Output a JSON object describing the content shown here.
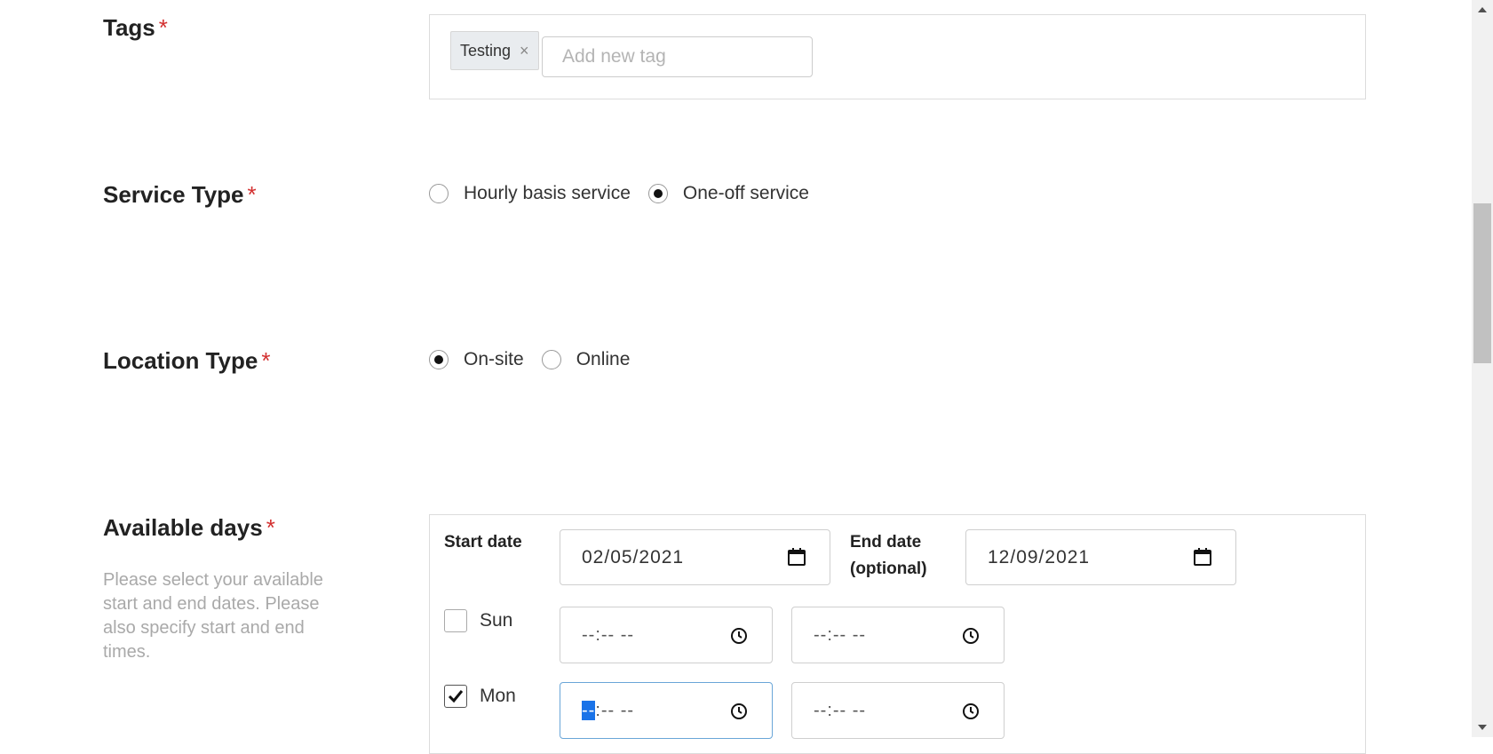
{
  "tags": {
    "label": "Tags",
    "required_mark": "*",
    "chip_label": "Testing",
    "chip_remove": "×",
    "input_placeholder": "Add new tag"
  },
  "service_type": {
    "label": "Service Type",
    "required_mark": "*",
    "options": [
      {
        "label": "Hourly basis service",
        "selected": false
      },
      {
        "label": "One-off service",
        "selected": true
      }
    ]
  },
  "location_type": {
    "label": "Location Type",
    "required_mark": "*",
    "options": [
      {
        "label": "On-site",
        "selected": true
      },
      {
        "label": "Online",
        "selected": false
      }
    ]
  },
  "available_days": {
    "label": "Available days",
    "required_mark": "*",
    "help_text": "Please select your available start and end dates. Please also specify start and end times.",
    "start_date_label": "Start date",
    "start_date_value": "02/05/2021",
    "end_date_label_line1": "End date",
    "end_date_label_line2": "(optional)",
    "end_date_value": "12/09/2021",
    "days": [
      {
        "name": "Sun",
        "checked": false,
        "start_hh": "--",
        "start_rest": ":-- --",
        "end_time": "--:-- --"
      },
      {
        "name": "Mon",
        "checked": true,
        "start_hh": "--",
        "start_rest": ":-- --",
        "end_time": "--:-- --"
      }
    ]
  },
  "icons": {
    "calendar": "calendar-icon",
    "clock": "clock-icon",
    "check": "check-icon"
  },
  "colors": {
    "required": "#d32f2f",
    "focus": "#6aa6d8",
    "selection": "#1a73e8"
  }
}
